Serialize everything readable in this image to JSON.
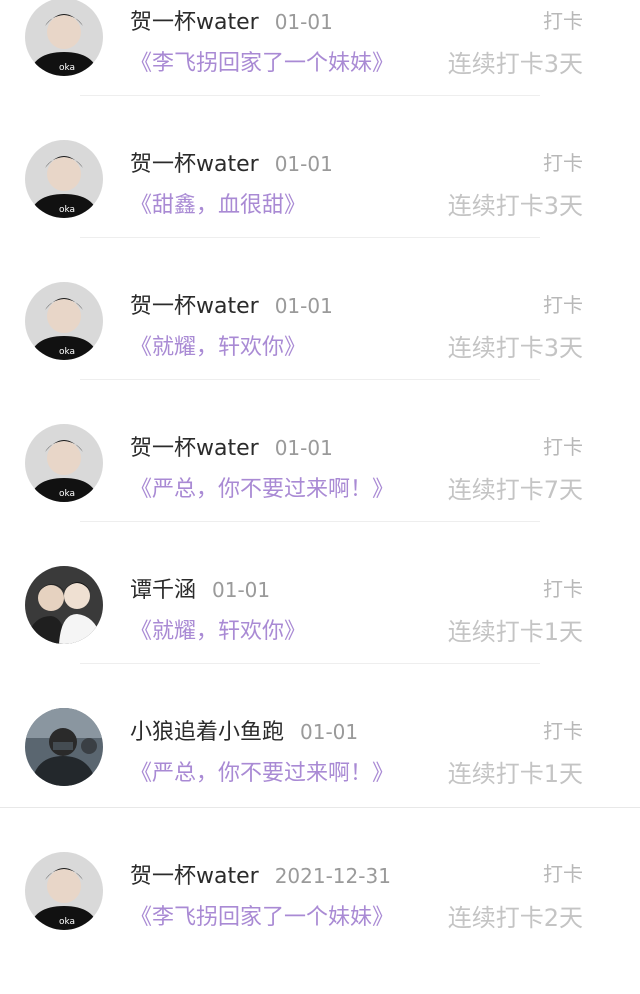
{
  "feed": {
    "items": [
      {
        "user": "贺一杯water",
        "date": "01-01",
        "book": "《李飞拐回家了一个妹妹》",
        "action": "打卡",
        "streak": "连续打卡3天",
        "avatar": "avatar-boy-black"
      },
      {
        "user": "贺一杯water",
        "date": "01-01",
        "book": "《甜鑫，血很甜》",
        "action": "打卡",
        "streak": "连续打卡3天",
        "avatar": "avatar-boy-black"
      },
      {
        "user": "贺一杯water",
        "date": "01-01",
        "book": "《就耀，轩欢你》",
        "action": "打卡",
        "streak": "连续打卡3天",
        "avatar": "avatar-boy-black"
      },
      {
        "user": "贺一杯water",
        "date": "01-01",
        "book": "《严总，你不要过来啊！》",
        "action": "打卡",
        "streak": "连续打卡7天",
        "avatar": "avatar-boy-black"
      },
      {
        "user": "谭千涵",
        "date": "01-01",
        "book": "《就耀，轩欢你》",
        "action": "打卡",
        "streak": "连续打卡1天",
        "avatar": "avatar-two-people"
      },
      {
        "user": "小狼追着小鱼跑",
        "date": "01-01",
        "book": "《严总，你不要过来啊！》",
        "action": "打卡",
        "streak": "连续打卡1天",
        "avatar": "avatar-dark-photo"
      },
      {
        "user": "贺一杯water",
        "date": "2021-12-31",
        "book": "《李飞拐回家了一个妹妹》",
        "action": "打卡",
        "streak": "连续打卡2天",
        "avatar": "avatar-boy-black"
      }
    ]
  },
  "colors": {
    "book_title": "#a98ad4",
    "username": "#2b2b2b",
    "date": "#9a9a9a",
    "action": "#b8b8b8",
    "streak": "#c4c4c4"
  }
}
